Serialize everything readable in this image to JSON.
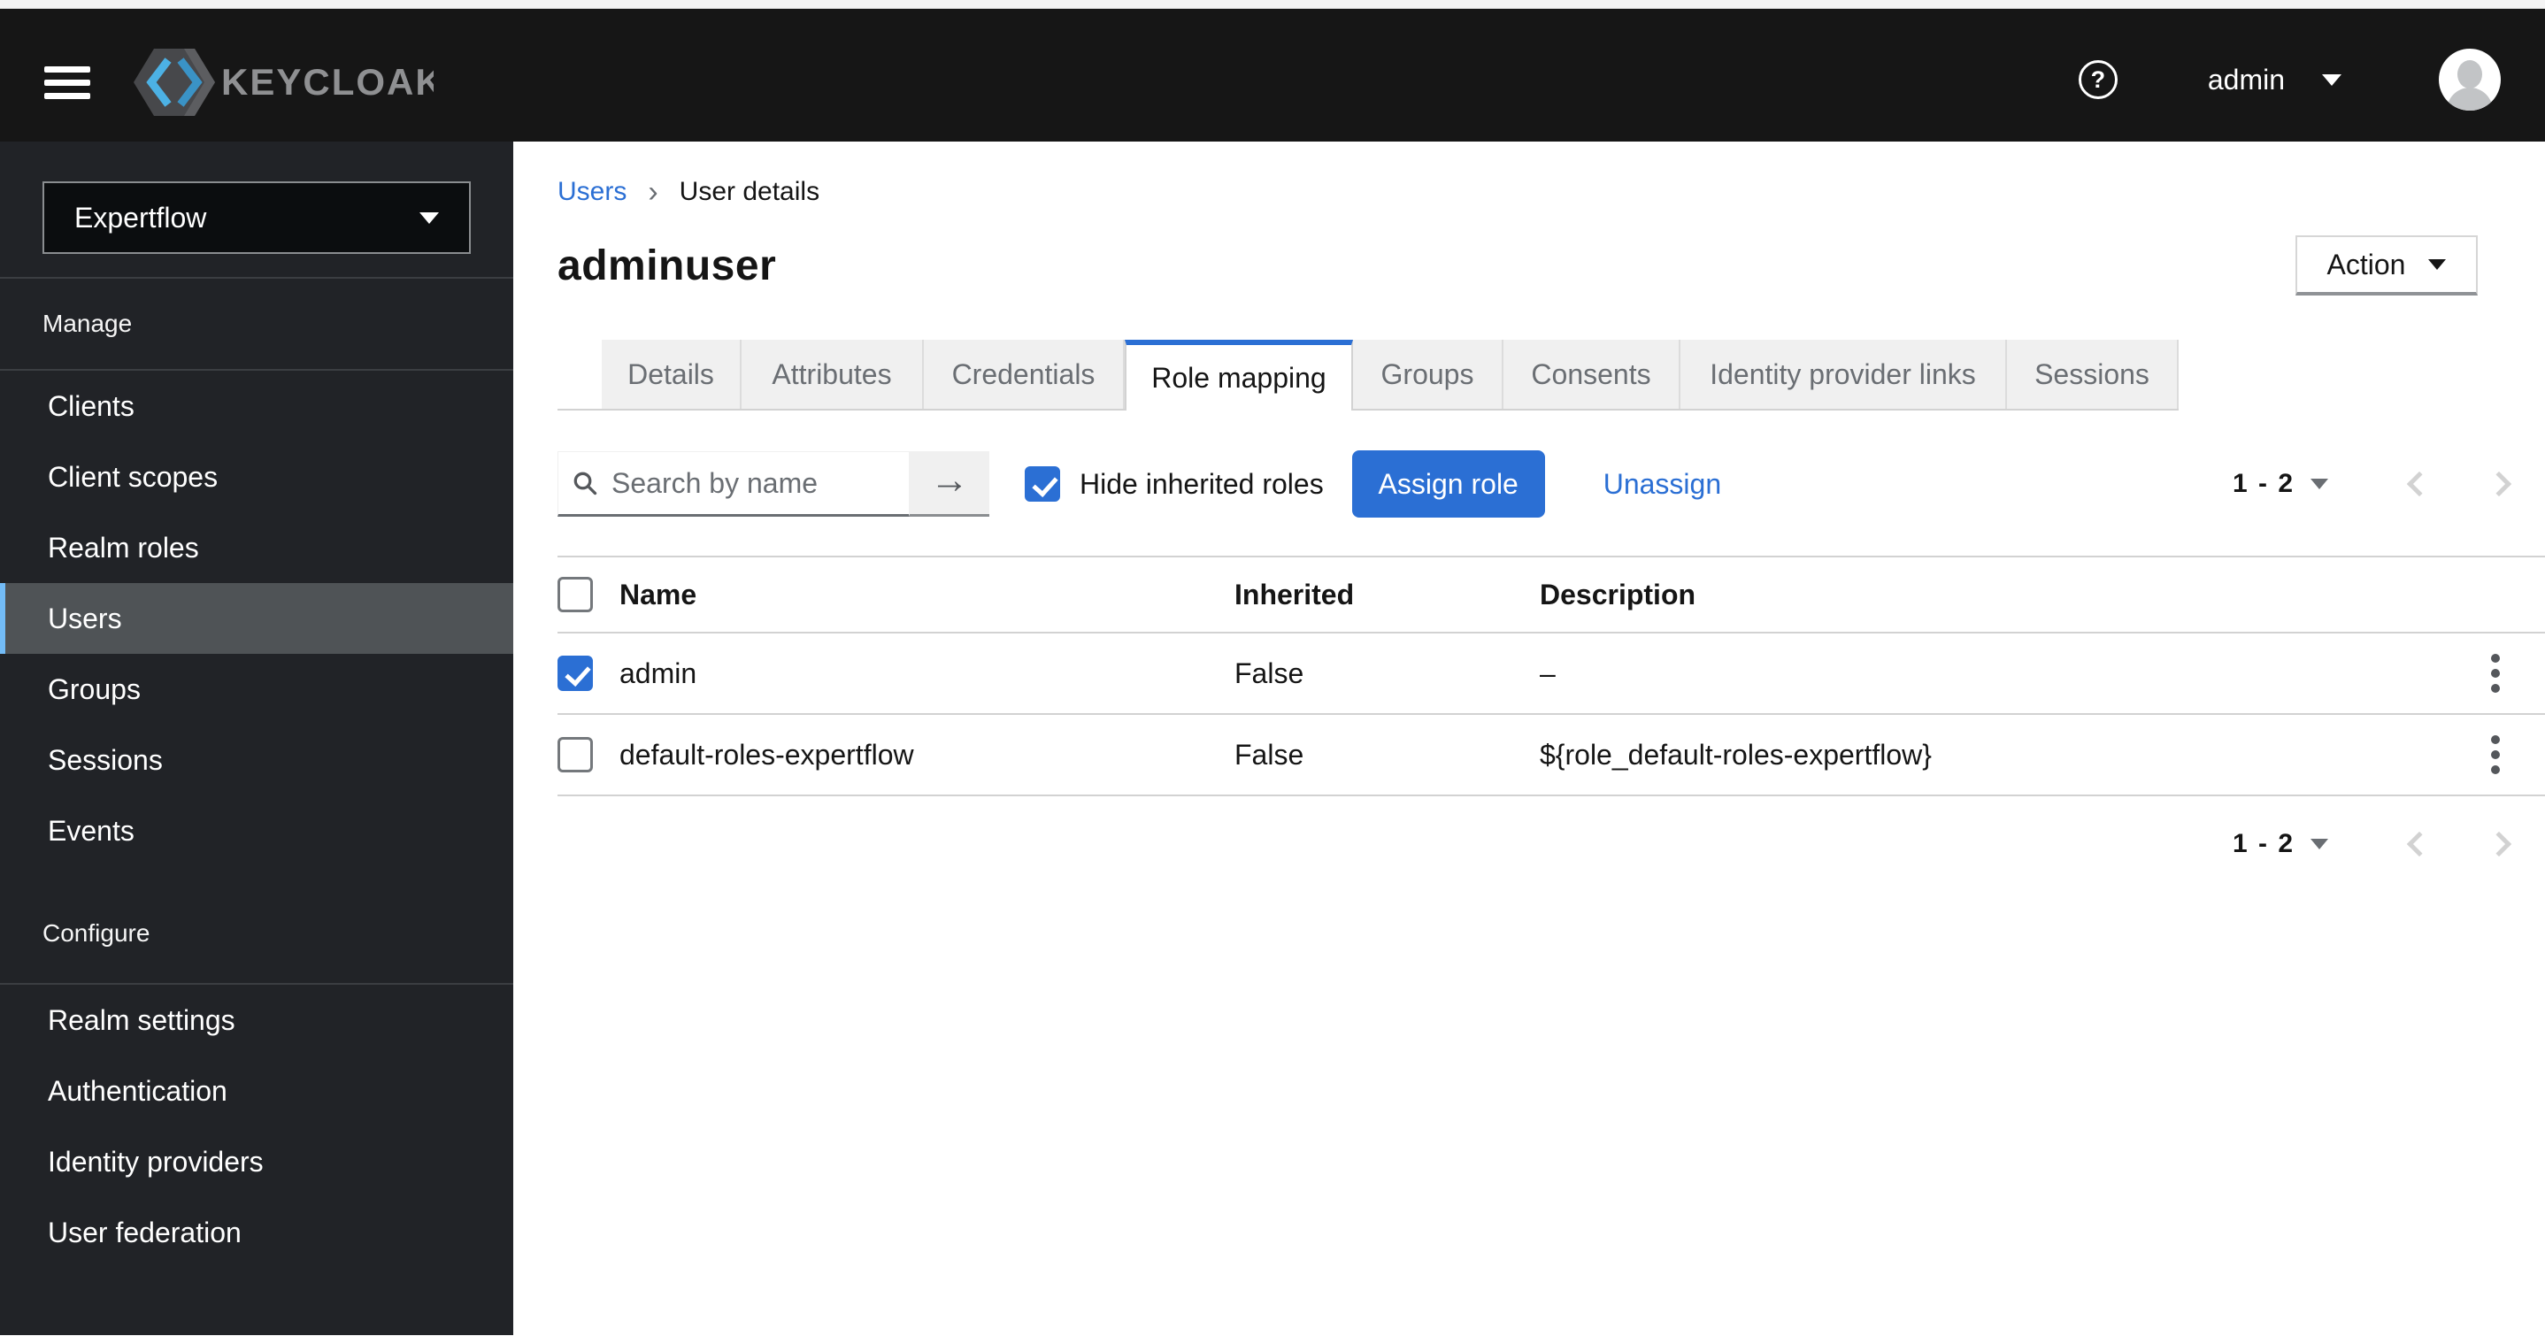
{
  "masthead": {
    "brand": "KEYCLOAK",
    "user": "admin",
    "help_glyph": "?"
  },
  "sidebar": {
    "realm": "Expertflow",
    "selected_item": "Users",
    "sections": [
      {
        "label": "Manage",
        "items": [
          "Clients",
          "Client scopes",
          "Realm roles",
          "Users",
          "Groups",
          "Sessions",
          "Events"
        ]
      },
      {
        "label": "Configure",
        "items": [
          "Realm settings",
          "Authentication",
          "Identity providers",
          "User federation"
        ]
      }
    ]
  },
  "breadcrumb": {
    "link": "Users",
    "separator": "›",
    "current": "User details"
  },
  "page": {
    "title": "adminuser",
    "action_label": "Action"
  },
  "tabs": [
    {
      "label": "Details",
      "active": false
    },
    {
      "label": "Attributes",
      "active": false
    },
    {
      "label": "Credentials",
      "active": false
    },
    {
      "label": "Role mapping",
      "active": true
    },
    {
      "label": "Groups",
      "active": false
    },
    {
      "label": "Consents",
      "active": false
    },
    {
      "label": "Identity provider links",
      "active": false
    },
    {
      "label": "Sessions",
      "active": false
    }
  ],
  "toolbar": {
    "search_placeholder": "Search by name",
    "search_value": "",
    "submit_arrow_glyph": "→",
    "hide_inherited_label": "Hide inherited roles",
    "hide_inherited_checked": true,
    "assign_label": "Assign role",
    "unassign_label": "Unassign",
    "pagination_range": "1 - 2"
  },
  "table": {
    "headers": [
      "Name",
      "Inherited",
      "Description"
    ],
    "header_checkbox_checked": false,
    "rows": [
      {
        "checked": true,
        "name": "admin",
        "inherited": "False",
        "description": "–"
      },
      {
        "checked": false,
        "name": "default-roles-expertflow",
        "inherited": "False",
        "description": "${role_default-roles-expertflow}"
      }
    ]
  },
  "colors": {
    "accent_blue": "#2b6fd4",
    "checkbox_blue": "#2b6fd4",
    "masthead_bg": "#161616",
    "sidebar_bg": "#212327",
    "sidebar_selected_bg": "#4f5356",
    "sidebar_selected_accent": "#73bcf7",
    "tab_inactive_bg": "#f0f0f0",
    "border_gray": "#d2d2d2",
    "text_secondary": "#6a6e73"
  }
}
